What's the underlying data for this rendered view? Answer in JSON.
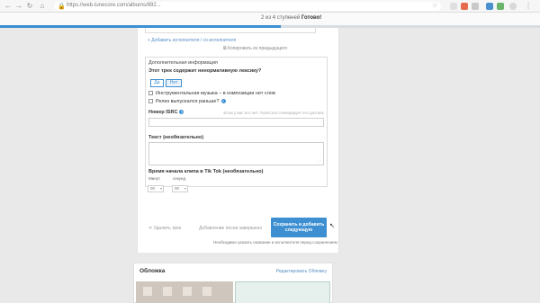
{
  "browser": {
    "url": "https://web.tunecore.com/albums/892..."
  },
  "progress": {
    "text": "2 из 4 ступеней",
    "status": "Готово!",
    "fraction": 0.52
  },
  "track_form": {
    "add_artist_link": "+ Добавить исполнителя / со-исполнителя",
    "copy_previous_link": "Копировать из предыдущего",
    "additional_info_title": "Дополнительная информация",
    "explicit_question": "Этот трек содержит ненормативную лексику?",
    "yes_label": "Да",
    "no_label": "Нет",
    "instrumental_label": "Инструментальная музыка – в композиции нет слов",
    "released_before_label": "Релиз выпускался раньше?",
    "isrc_label": "Номер ISRC",
    "isrc_hint": "Если у вас его нет, TuneCore сгенерирует его для вас",
    "lyrics_label": "Текст (необязательно)",
    "tiktok_label": "Время начала клипа в Tik Tok (необязательно)",
    "minutes_label": "Минут",
    "seconds_label": "секунд",
    "minutes_value": "00",
    "seconds_value": "00",
    "delete_track": "Удалить трек",
    "add_another": "Добавление песни завершено",
    "save_button": "Сохранить и добавить следующую",
    "save_note": "Необходимо указать название и исполнителя перед сохранением"
  },
  "cover": {
    "title": "Обложка",
    "edit_link": "Редактировать Обложку"
  },
  "colors": {
    "accent": "#3d8fd1"
  }
}
